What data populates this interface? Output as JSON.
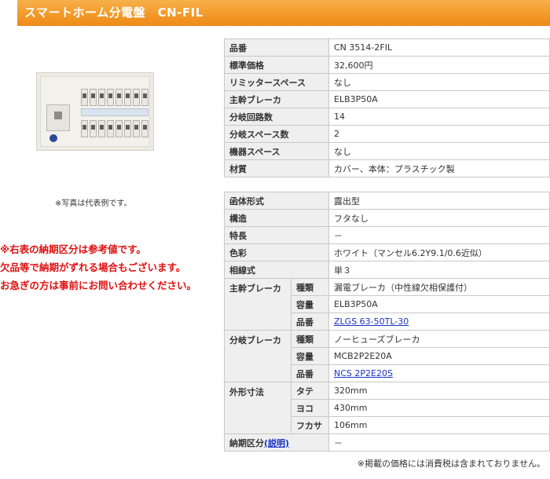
{
  "page": {
    "title": "スマートホーム分電盤　CN-FIL"
  },
  "photo": {
    "note": "※写真は代表例です。"
  },
  "notice": {
    "lines": [
      "※右表の納期区分は参考値です。",
      "欠品等で納期がずれる場合もございます。",
      "お急ぎの方は事前にお問い合わせください。"
    ],
    "color": "#e01010"
  },
  "spec_basic": [
    {
      "label": "品番",
      "value": "CN 3514-2FIL"
    },
    {
      "label": "標準価格",
      "value": "32,600円"
    },
    {
      "label": "リミッタースペース",
      "value": "なし"
    },
    {
      "label": "主幹ブレーカ",
      "value": "ELB3P50A"
    },
    {
      "label": "分岐回路数",
      "value": "14"
    },
    {
      "label": "分岐スペース数",
      "value": "2"
    },
    {
      "label": "機器スペース",
      "value": "なし"
    },
    {
      "label": "材質",
      "value": "カバー、本体：プラスチック製"
    }
  ],
  "spec_detail": {
    "case_type": {
      "label": "函体形式",
      "value": "露出型"
    },
    "structure": {
      "label": "構造",
      "value": "フタなし"
    },
    "features": {
      "label": "特長",
      "value": "－"
    },
    "color": {
      "label": "色彩",
      "value": "ホワイト（マンセル6.2Y9.1/0.6近似）"
    },
    "phase": {
      "label": "相線式",
      "value": "単３"
    },
    "main_breaker": {
      "label": "主幹ブレーカ",
      "type_label": "種類",
      "type": "漏電ブレーカ（中性線欠相保護付）",
      "capacity_label": "容量",
      "capacity": "ELB3P50A",
      "part_label": "品番",
      "part": "ZLGS 63-50TL-30"
    },
    "branch_breaker": {
      "label": "分岐ブレーカ",
      "type_label": "種類",
      "type": "ノーヒューズブレーカ",
      "capacity_label": "容量",
      "capacity": "MCB2P2E20A",
      "part_label": "品番",
      "part": "NCS 2P2E20S"
    },
    "dimensions": {
      "label": "外形寸法",
      "height_label": "タテ",
      "height": "320mm",
      "width_label": "ヨコ",
      "width": "430mm",
      "depth_label": "フカサ",
      "depth": "106mm"
    },
    "delivery": {
      "label": "納期区分",
      "link": "(説明)",
      "value": "－"
    }
  },
  "tax_note": "※掲載の価格には消費税は含まれておりません。",
  "colors": {
    "title_bar": "#f29a2a",
    "link": "#1a33c4",
    "label_bg": "#efefef"
  }
}
